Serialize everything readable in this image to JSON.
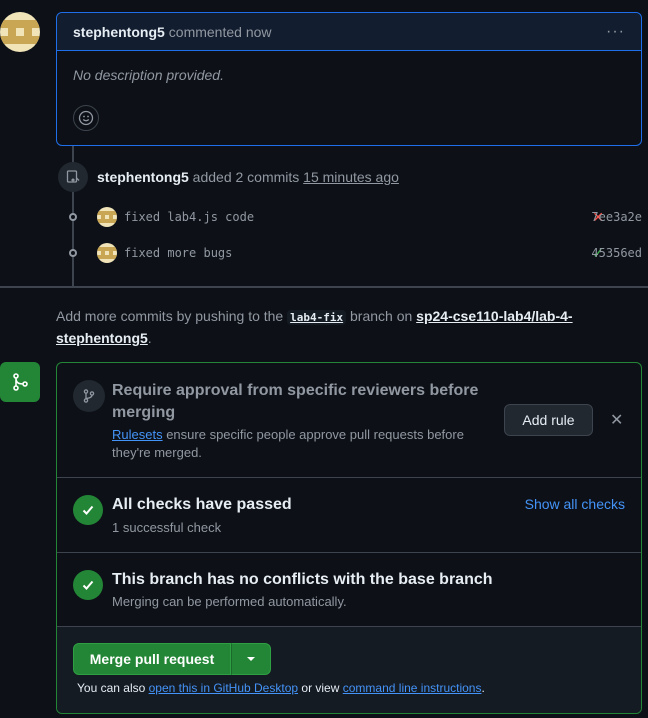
{
  "comment": {
    "author": "stephentong5",
    "meta": "commented now",
    "body": "No description provided."
  },
  "push_event": {
    "author": "stephentong5",
    "action": "added 2 commits",
    "time": "15 minutes ago"
  },
  "commits": [
    {
      "message": "fixed lab4.js code",
      "status": "failure",
      "status_glyph": "✕",
      "sha": "7ee3a2e"
    },
    {
      "message": "fixed more bugs",
      "status": "success",
      "status_glyph": "✓",
      "sha": "45356ed"
    }
  ],
  "branch_info": {
    "prefix": "Add more commits by pushing to the",
    "branch": "lab4-fix",
    "middle": "branch on",
    "repo": "sp24-cse110-lab4/lab-4-stephentong5",
    "suffix": "."
  },
  "merge": {
    "review_title": "Require approval from specific reviewers before merging",
    "review_link": "Rulesets",
    "review_desc": "ensure specific people approve pull requests before they're merged.",
    "add_rule": "Add rule",
    "checks_title": "All checks have passed",
    "checks_sub": "1 successful check",
    "show_checks": "Show all checks",
    "conflicts_title": "This branch has no conflicts with the base branch",
    "conflicts_sub": "Merging can be performed automatically.",
    "merge_button": "Merge pull request",
    "also_prefix": "You can also",
    "desktop_link": "open this in GitHub Desktop",
    "also_middle": "or view",
    "cli_link": "command line instructions",
    "also_suffix": "."
  },
  "colors": {
    "accent_blue": "#1f6feb",
    "success_green": "#238636",
    "failure_red": "#f85149",
    "success_check": "#3fb950"
  }
}
